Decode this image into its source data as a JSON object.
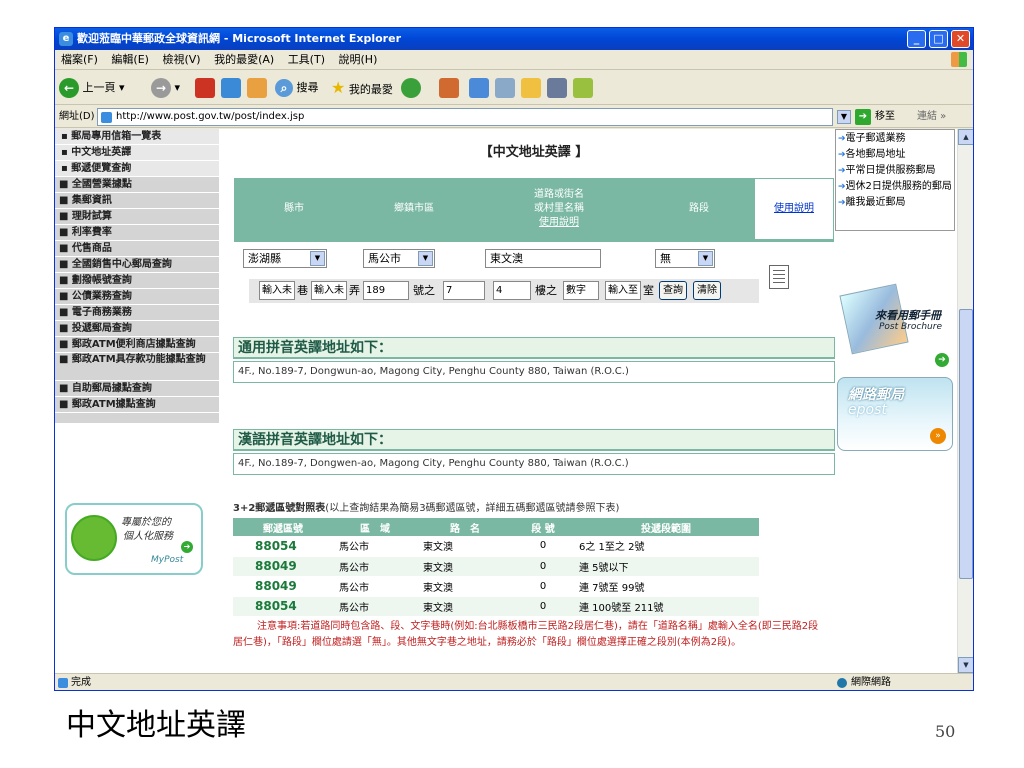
{
  "window": {
    "title": "歡迎蒞臨中華郵政全球資訊網 - Microsoft Internet Explorer"
  },
  "menu": [
    "檔案(F)",
    "編輯(E)",
    "檢視(V)",
    "我的最愛(A)",
    "工具(T)",
    "說明(H)"
  ],
  "toolbar": {
    "back": "上一頁",
    "search": "搜尋",
    "favorites": "我的最愛"
  },
  "address": {
    "label": "網址(D)",
    "url": "http://www.post.gov.tw/post/index.jsp",
    "go": "移至",
    "links": "連結 »"
  },
  "sidebar": {
    "items": [
      {
        "label": "▪ 郵局專用信箱一覽表",
        "type": "sub"
      },
      {
        "label": "▪ 中文地址英譯",
        "type": "sub"
      },
      {
        "label": "▪ 郵遞便覽查詢",
        "type": "sub"
      },
      {
        "label": "■ 全國營業據點",
        "type": "main"
      },
      {
        "label": "■ 集郵資訊",
        "type": "main"
      },
      {
        "label": "■ 理財試算",
        "type": "main"
      },
      {
        "label": "■ 利率費率",
        "type": "main"
      },
      {
        "label": "■ 代售商品",
        "type": "main"
      },
      {
        "label": "■ 全國銷售中心郵局查詢",
        "type": "main"
      },
      {
        "label": "■ 劃撥帳號查詢",
        "type": "main"
      },
      {
        "label": "■ 公債業務查詢",
        "type": "main"
      },
      {
        "label": "■ 電子商務業務",
        "type": "main"
      },
      {
        "label": "■ 投遞郵局查詢",
        "type": "main"
      },
      {
        "label": "■ 郵政ATM便利商店據點查詢",
        "type": "main"
      },
      {
        "label": "■ 郵政ATM具存款功能據點查詢",
        "type": "tall"
      },
      {
        "label": "■ 自助郵局據點查詢",
        "type": "main"
      },
      {
        "label": "■ 郵政ATM據點查詢",
        "type": "main"
      }
    ],
    "mypost": {
      "line1": "專屬於您的",
      "line2": "個人化服務",
      "brand": "MyPost"
    }
  },
  "main": {
    "title": "【中文地址英譯 】",
    "headers": {
      "county": "縣市",
      "town": "鄉鎮市區",
      "road_l1": "道路或街名",
      "road_l2": "或村里名稱",
      "road_help": "使用說明",
      "section": "路段",
      "help": "使用說明"
    },
    "form": {
      "county": "澎湖縣",
      "town": "馬公市",
      "road": "東文澳",
      "section": "無",
      "lane_ph": "輸入未",
      "lane_lbl": "巷",
      "alley_ph": "輸入未",
      "alley_lbl": "弄",
      "no": "189",
      "no_lbl": "號之",
      "no_sub": "7",
      "floor": "4",
      "floor_lbl": "樓之",
      "floor_sub": "數字",
      "room_ph": "輸入至",
      "room_lbl": "室",
      "query": "查詢",
      "clear": "清除"
    },
    "result1_title": "通用拼音英譯地址如下：",
    "result1": "4F., No.189-7, Dongwun-ao, Magong City, Penghu County 880, Taiwan (R.O.C.)",
    "result2_title": "漢語拼音英譯地址如下：",
    "result2": "4F., No.189-7, Dongwen-ao, Magong City, Penghu County 880, Taiwan (R.O.C.)",
    "table_title_bold": "3+2郵遞區號對照表",
    "table_title_rest": "(以上查詢結果為簡易3碼郵遞區號，詳細五碼郵遞區號請參照下表)",
    "table_headers": [
      "郵遞區號",
      "區　域",
      "路　名",
      "段 號",
      "投遞段範圍"
    ],
    "rows": [
      [
        "88054",
        "馬公市",
        "東文澳",
        "0",
        "6之 1至之 2號"
      ],
      [
        "88049",
        "馬公市",
        "東文澳",
        "0",
        "連 5號以下"
      ],
      [
        "88049",
        "馬公市",
        "東文澳",
        "0",
        "連 7號至 99號"
      ],
      [
        "88054",
        "馬公市",
        "東文澳",
        "0",
        "連 100號至 211號"
      ]
    ],
    "note": "注意事項:若道路同時包含路、段、文字巷時(例如:台北縣板橋市三民路2段居仁巷)，請在「道路名稱」處輸入全名(即三民路2段居仁巷)，「路段」欄位處請選「無」。其他無文字巷之地址，請務必於「路段」欄位處選擇正確之段別(本例為2段)。"
  },
  "right": {
    "links": [
      "電子郵遞業務",
      "各地郵局地址",
      "平常日提供服務郵局",
      "週休2日提供服務的郵局",
      "離我最近郵局"
    ],
    "brochure_title": "來看用郵手冊",
    "brochure_sub": "Post Brochure",
    "epost_title": "網路郵局",
    "epost_sub": "epost"
  },
  "status": {
    "text": "完成",
    "zone": "網際網路"
  },
  "slide": {
    "caption": "中文地址英譯",
    "page": "50"
  }
}
